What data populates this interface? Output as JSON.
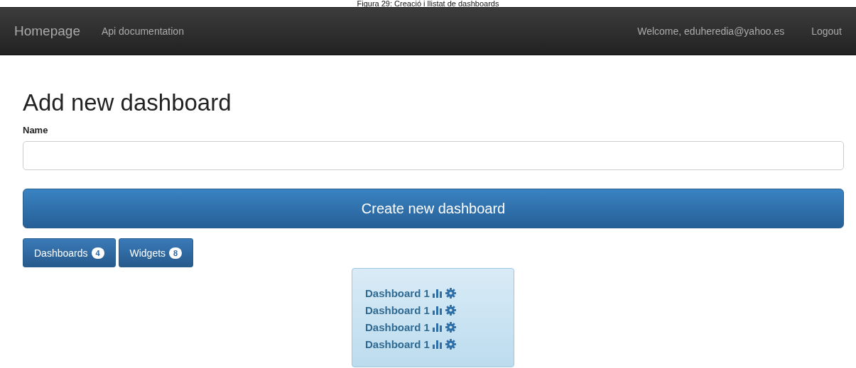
{
  "caption": "Figura 29: Creació i llistat de dashboards",
  "navbar": {
    "brand": "Homepage",
    "links": [
      "Api documentation"
    ],
    "welcome": "Welcome, eduheredia@yahoo.es",
    "logout": "Logout"
  },
  "form": {
    "heading": "Add new dashboard",
    "label": "Name",
    "submit": "Create new dashboard"
  },
  "tabs": [
    {
      "label": "Dashboards",
      "count": "4"
    },
    {
      "label": "Widgets",
      "count": "8"
    }
  ],
  "dashboards": [
    {
      "name": "Dashboard 1"
    },
    {
      "name": "Dashboard 1"
    },
    {
      "name": "Dashboard 1"
    },
    {
      "name": "Dashboard 1"
    }
  ]
}
